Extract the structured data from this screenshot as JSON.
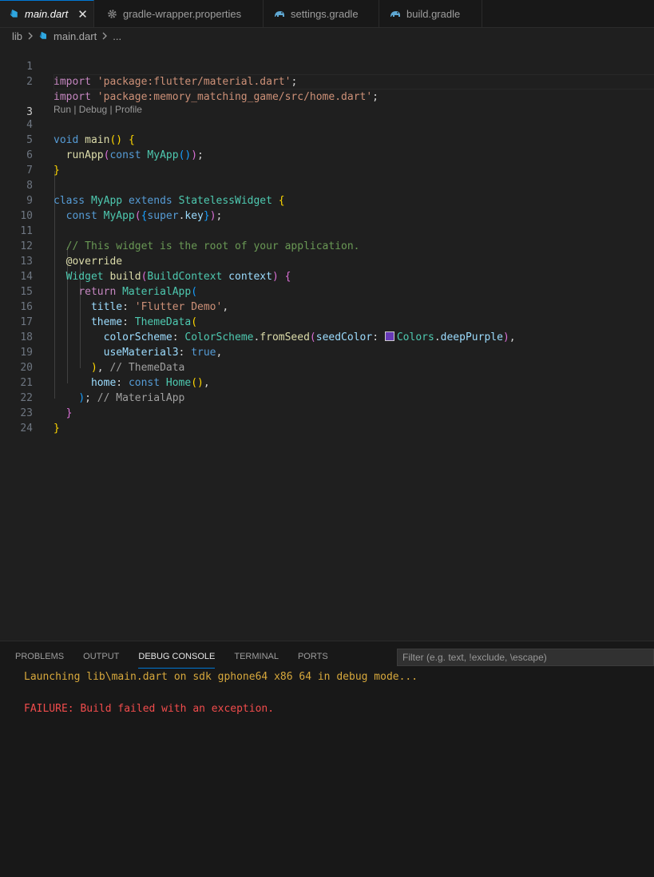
{
  "tabs": [
    {
      "label": "main.dart",
      "icon": "dart-icon",
      "active": true,
      "close": "✕"
    },
    {
      "label": "gradle-wrapper.properties",
      "icon": "gear-icon"
    },
    {
      "label": "settings.gradle",
      "icon": "gradle-elephant-icon"
    },
    {
      "label": "build.gradle",
      "icon": "gradle-elephant-icon"
    }
  ],
  "breadcrumb": {
    "folder": "lib",
    "file": "main.dart",
    "more": "..."
  },
  "code_lens": "Run | Debug | Profile",
  "line_numbers": [
    "1",
    "2",
    "3",
    "4",
    "5",
    "6",
    "7",
    "8",
    "9",
    "10",
    "11",
    "12",
    "13",
    "14",
    "15",
    "16",
    "17",
    "18",
    "19",
    "20",
    "21",
    "22",
    "23",
    "24"
  ],
  "code": {
    "l1": {
      "kw": "import",
      "str": "'package:flutter/material.dart'",
      "end": ";"
    },
    "l2": {
      "kw": "import",
      "str": "'package:memory_matching_game/src/home.dart'",
      "end": ";"
    },
    "l4": {
      "kw": "void",
      "fn": "main",
      "open": "()",
      "brace": "{"
    },
    "l5": {
      "fn": "runApp",
      "p1": "(",
      "kw": "const",
      "cls": "MyApp",
      "p2": "()",
      "p3": ")",
      "end": ";"
    },
    "l6": {
      "brace": "}"
    },
    "l8": {
      "kw1": "class",
      "cls1": "MyApp",
      "kw2": "extends",
      "cls2": "StatelessWidget",
      "brace": "{"
    },
    "l9": {
      "kw": "const",
      "cls": "MyApp",
      "p1": "(",
      "p2": "{",
      "kw2": "super",
      "dot": ".",
      "var": "key",
      "p3": "}",
      "p4": ")",
      "end": ";"
    },
    "l11": {
      "comment": "// This widget is the root of your application."
    },
    "l12": {
      "ann": "@override"
    },
    "l13": {
      "cls1": "Widget",
      "fn": "build",
      "p1": "(",
      "cls2": "BuildContext",
      "var": "context",
      "p2": ")",
      "brace": "{"
    },
    "l14": {
      "kw": "return",
      "cls": "MaterialApp",
      "p": "("
    },
    "l15": {
      "var": "title",
      "colon": ":",
      "str": "'Flutter Demo'",
      "comma": ","
    },
    "l16": {
      "var": "theme",
      "colon": ":",
      "cls": "ThemeData",
      "p": "("
    },
    "l17": {
      "var": "colorScheme",
      "colon": ":",
      "cls1": "ColorScheme",
      "dot": ".",
      "fn": "fromSeed",
      "p1": "(",
      "var2": "seedColor",
      "colon2": ":",
      "swatch_color": "#673ab7",
      "cls2": "Colors",
      "dot2": ".",
      "var3": "deepPurple",
      "p2": ")",
      "comma": ","
    },
    "l18": {
      "var": "useMaterial3",
      "colon": ":",
      "kw": "true",
      "comma": ","
    },
    "l19": {
      "p": ")",
      "comma": ",",
      "comment": "// ThemeData"
    },
    "l20": {
      "var": "home",
      "colon": ":",
      "kw": "const",
      "cls": "Home",
      "p": "()",
      "comma": ","
    },
    "l21": {
      "p": ")",
      "end": ";",
      "comment": "// MaterialApp"
    },
    "l22": {
      "brace": "}"
    },
    "l23": {
      "brace": "}"
    }
  },
  "panel": {
    "tabs": [
      "PROBLEMS",
      "OUTPUT",
      "DEBUG CONSOLE",
      "TERMINAL",
      "PORTS"
    ],
    "active_tab": "DEBUG CONSOLE",
    "filter_placeholder": "Filter (e.g. text, !exclude, \\escape)",
    "output": [
      {
        "text": "Launching lib\\main.dart on sdk gphone64 x86 64 in debug mode...",
        "kind": "info"
      },
      {
        "text": "FAILURE: Build failed with an exception.",
        "kind": "error"
      }
    ]
  },
  "colors": {
    "accent": "#0078d4",
    "editor_bg": "#1f1f1f",
    "panel_bg": "#181818",
    "error": "#f14c4c",
    "info": "#d7ba7d"
  }
}
